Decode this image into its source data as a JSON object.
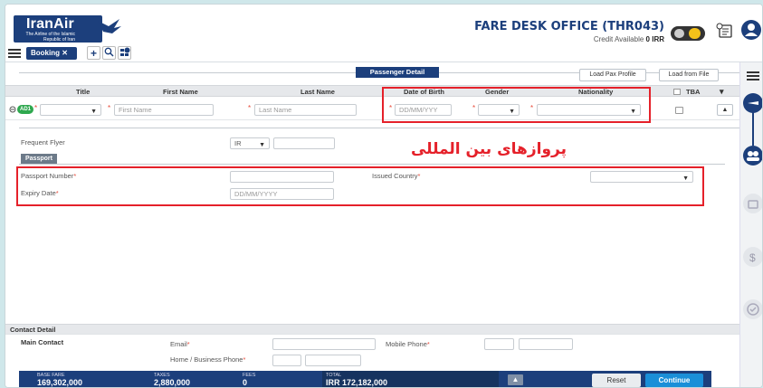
{
  "logo": {
    "name": "IranAir",
    "tagline": "The Airline of the Islamic Republic of Iran"
  },
  "office": {
    "title": "FARE DESK OFFICE (THR043)",
    "credit_label": "Credit Available",
    "credit_value": "0 IRR"
  },
  "toolbar": {
    "tab_label": "Booking ✕",
    "add": "+",
    "search": "🔍"
  },
  "section": {
    "title": "Passenger Detail",
    "load_pax_profile": "Load Pax Profile",
    "load_from_file": "Load from File"
  },
  "columns": {
    "title": "Title",
    "first_name": "First Name",
    "last_name": "Last Name",
    "dob": "Date of Birth",
    "gender": "Gender",
    "nationality": "Nationality",
    "tba": "TBA"
  },
  "passenger": {
    "badge": "AD1",
    "first_name_placeholder": "First Name",
    "last_name_placeholder": "Last Name",
    "dob_placeholder": "DD/MM/YYY"
  },
  "frequent_flyer": {
    "label": "Frequent Flyer",
    "code": "IR"
  },
  "passport": {
    "tab": "Passport",
    "number_label": "Passport Number",
    "expiry_label": "Expiry Date",
    "expiry_placeholder": "DD/MM/YYYY",
    "issued_country_label": "Issued Country"
  },
  "annotation": {
    "farsi": "پروازهای بین المللی"
  },
  "contact": {
    "section_title": "Contact Detail",
    "main_contact": "Main Contact",
    "email_label": "Email",
    "mobile_label": "Mobile Phone",
    "home_label": "Home / Business Phone"
  },
  "footer": {
    "base_fare_label": "BASE FARE",
    "base_fare": "169,302,000",
    "taxes_label": "TAXES",
    "taxes": "2,880,000",
    "fees_label": "FEES",
    "fees": "0",
    "total_label": "TOTAL",
    "total": "IRR 172,182,000",
    "reset": "Reset",
    "continue": "Continue"
  },
  "colors": {
    "brand": "#1c3f7c",
    "annotation_red": "#e5212a",
    "required": "#e74c3c"
  }
}
